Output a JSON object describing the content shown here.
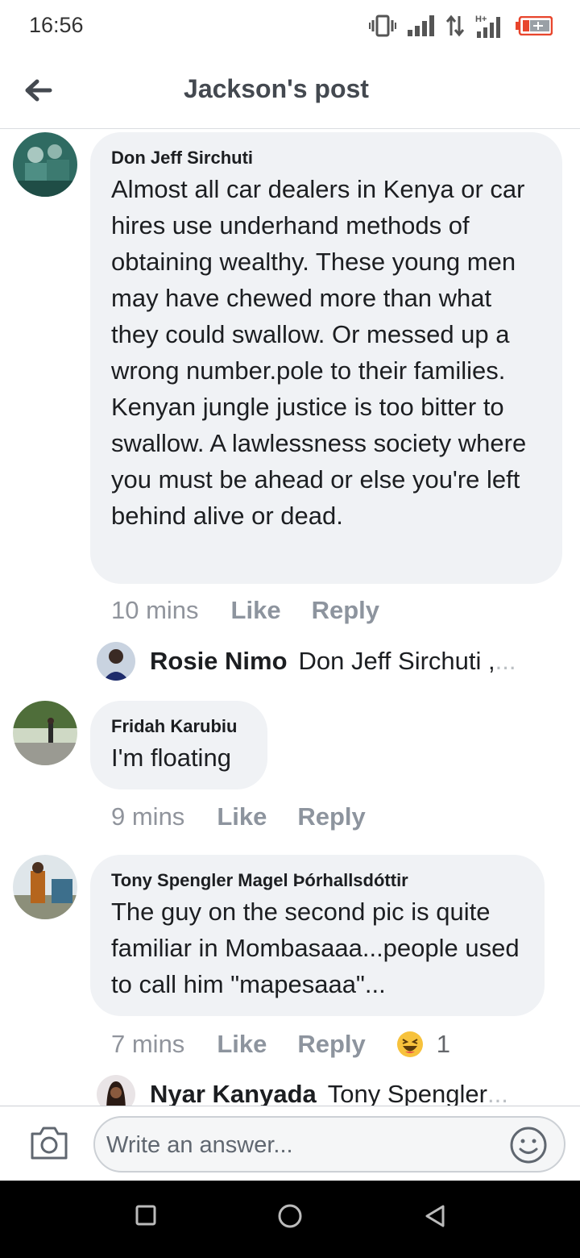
{
  "status_bar": {
    "time": "16:56",
    "icons": [
      "vibrate-icon",
      "signal-icon",
      "data-arrows-icon",
      "hplus-signal-icon",
      "battery-icon"
    ],
    "hplus_label": "H+"
  },
  "header": {
    "title": "Jackson's post",
    "back_icon": "back-arrow-icon"
  },
  "comments": [
    {
      "author": "Don Jeff Sirchuti",
      "text": "Almost all car dealers in Kenya or car hires use underhand methods of obtaining wealthy. These young men may have chewed more than what they could swallow. Or messed up a wrong number.pole to their families. Kenyan jungle justice is too bitter to swallow. A lawlessness society where you must be ahead or else you're left behind alive or dead.",
      "time": "10 mins",
      "like": "Like",
      "reply": "Reply",
      "reply_preview": {
        "name": "Rosie Nimo",
        "text": "Don Jeff Sirchuti ,",
        "more": "..."
      }
    },
    {
      "author": "Fridah Karubiu",
      "text": "I'm floating",
      "time": "9 mins",
      "like": "Like",
      "reply": "Reply"
    },
    {
      "author": "Tony Spengler Magel Þórhallsdóttir",
      "text": "The guy on the second pic is quite familiar in Mombasaaa...people used to call him \"mapesaaa\"...",
      "time": "7 mins",
      "like": "Like",
      "reply": "Reply",
      "reaction": {
        "icon": "laughing-emoji-icon",
        "count": "1"
      },
      "reply_preview": {
        "name": "Nyar Kanyada",
        "text": "Tony Spengler",
        "more": "..."
      }
    }
  ],
  "composer": {
    "placeholder": "Write an answer...",
    "camera_icon": "camera-icon",
    "emoji_icon": "smiley-icon"
  },
  "nav_bar": {
    "buttons": [
      "recents-square-icon",
      "home-circle-icon",
      "back-triangle-icon"
    ]
  },
  "colors": {
    "bubble": "#f0f2f5",
    "meta": "#90949c",
    "header_title": "#444950",
    "battery": "#e8452c"
  }
}
